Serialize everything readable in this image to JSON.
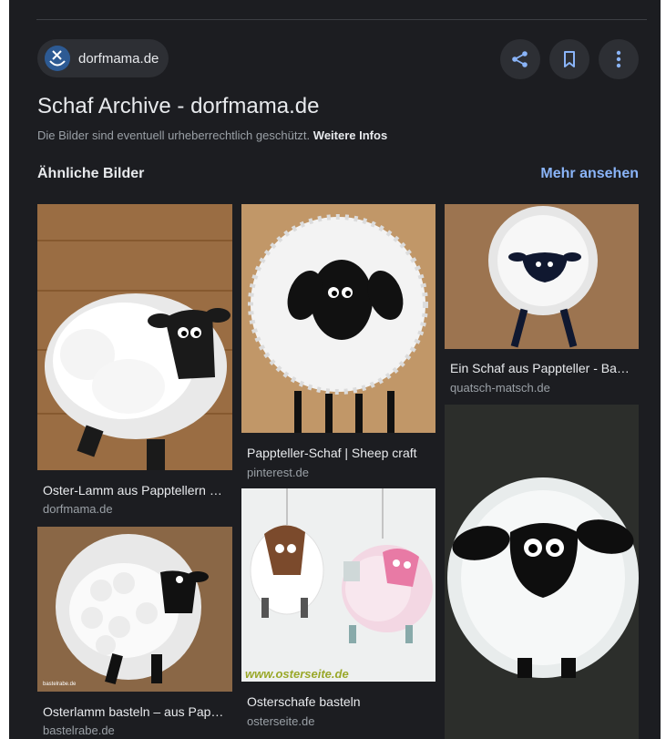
{
  "header": {
    "source_name": "dorfmama.de",
    "title": "Schaf Archive - dorfmama.de",
    "copyright_text": "Die Bilder sind eventuell urheberrechtlich geschützt.",
    "copyright_link": "Weitere Infos"
  },
  "icons": {
    "share": "share-icon",
    "bookmark": "bookmark-icon",
    "more": "more-vert-icon"
  },
  "similar": {
    "heading": "Ähnliche Bilder",
    "more_label": "Mehr ansehen",
    "items": [
      {
        "caption": "Oster-Lamm aus Papptellern basteln",
        "source": "dorfmama.de"
      },
      {
        "caption": "Pappteller-Schaf | Sheep craft",
        "source": "pinterest.de"
      },
      {
        "caption": "Ein Schaf aus Pappteller - Basteln",
        "source": "quatsch-matsch.de"
      },
      {
        "caption": "Osterlamm basteln – aus Pappteller",
        "source": "bastelrabe.de"
      },
      {
        "caption": "Osterschafe basteln",
        "source": "osterseite.de",
        "watermark": "www.osterseite.de"
      },
      {
        "caption": "",
        "source": ""
      }
    ],
    "small_watermark": "bastelrabe.de"
  },
  "colors": {
    "background": "#1c1d21",
    "accent": "#8ab4f8",
    "chip": "#2d2f34"
  }
}
